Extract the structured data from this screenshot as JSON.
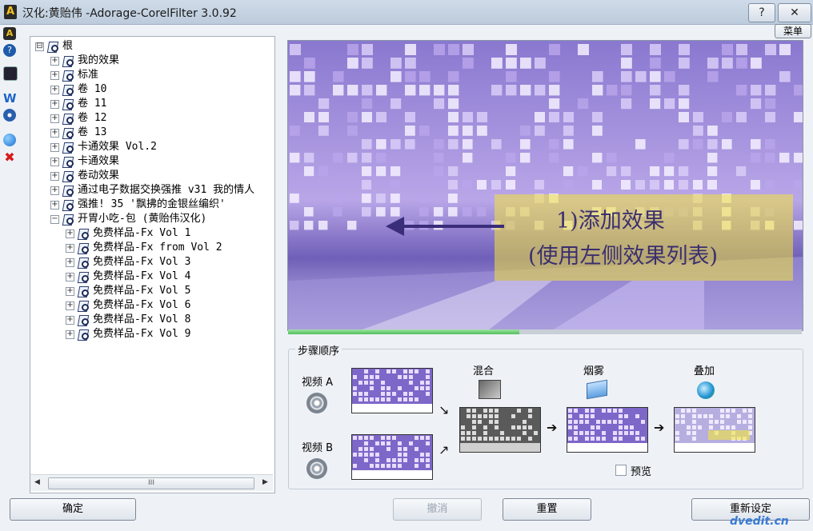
{
  "window": {
    "title": "汉化:黄贻伟 -Adorage-CorelFilter 3.0.92",
    "help_label": "?",
    "close_label": "✕",
    "menu_label": "菜单"
  },
  "tree": {
    "items": [
      {
        "label": "根",
        "level": 0,
        "expander": "⊟",
        "icon": "folder-open-icon"
      },
      {
        "label": "我的效果",
        "level": 1,
        "expander": "+",
        "icon": "effect-set-icon"
      },
      {
        "label": "标准",
        "level": 1,
        "expander": "+",
        "icon": "effect-set-icon"
      },
      {
        "label": "卷 10",
        "level": 1,
        "expander": "+",
        "icon": "effect-set-icon"
      },
      {
        "label": "卷 11",
        "level": 1,
        "expander": "+",
        "icon": "effect-set-icon"
      },
      {
        "label": "卷 12",
        "level": 1,
        "expander": "+",
        "icon": "effect-set-icon"
      },
      {
        "label": "卷 13",
        "level": 1,
        "expander": "+",
        "icon": "effect-set-icon"
      },
      {
        "label": "卡通效果 Vol.2",
        "level": 1,
        "expander": "+",
        "icon": "effect-set-icon"
      },
      {
        "label": "卡通效果",
        "level": 1,
        "expander": "+",
        "icon": "effect-set-icon"
      },
      {
        "label": "卷动效果",
        "level": 1,
        "expander": "+",
        "icon": "effect-set-icon"
      },
      {
        "label": "通过电子数据交换强推 v31 我的情人",
        "level": 1,
        "expander": "+",
        "icon": "effect-set-icon"
      },
      {
        "label": "强推! 35 '飘拂的金银丝编织'",
        "level": 1,
        "expander": "+",
        "icon": "effect-set-icon"
      },
      {
        "label": "开胃小吃-包 (黄贻伟汉化)",
        "level": 1,
        "expander": "−",
        "icon": "effect-set-icon"
      },
      {
        "label": "免费样品-Fx Vol 1",
        "level": 2,
        "expander": "+",
        "icon": "effect-set-icon"
      },
      {
        "label": "免费样品-Fx from Vol 2",
        "level": 2,
        "expander": "+",
        "icon": "effect-set-icon"
      },
      {
        "label": "免费样品-Fx Vol 3",
        "level": 2,
        "expander": "+",
        "icon": "effect-set-icon"
      },
      {
        "label": "免费样品-Fx Vol 4",
        "level": 2,
        "expander": "+",
        "icon": "effect-set-icon"
      },
      {
        "label": "免费样品-Fx Vol 5",
        "level": 2,
        "expander": "+",
        "icon": "effect-set-icon"
      },
      {
        "label": "免费样品-Fx Vol 6",
        "level": 2,
        "expander": "+",
        "icon": "effect-set-icon"
      },
      {
        "label": "免费样品-Fx Vol 8",
        "level": 2,
        "expander": "+",
        "icon": "effect-set-icon"
      },
      {
        "label": "免费样品-Fx Vol 9",
        "level": 2,
        "expander": "+",
        "icon": "effect-set-icon"
      }
    ],
    "scroll_left": "◀",
    "scroll_right": "▶",
    "scroll_thumb_grip": "III"
  },
  "preview": {
    "line1": "1)添加效果",
    "line2": "(使用左侧效果列表)",
    "progress_fraction": 0.45
  },
  "steps": {
    "legend": "步骤顺序",
    "video_a": "视频 A",
    "video_b": "视频 B",
    "mix": "混合",
    "fog": "烟雾",
    "overlay": "叠加",
    "preview_checkbox": "预览"
  },
  "buttons": {
    "ok": "确定",
    "cancel": "撤消",
    "reset": "重置",
    "last": "重新设定"
  },
  "watermark": "dvedit.cn",
  "colors": {
    "accent": "#8c7bd6",
    "highlight_yellow": "#f2e43a",
    "progress_green": "#4fbf59"
  }
}
